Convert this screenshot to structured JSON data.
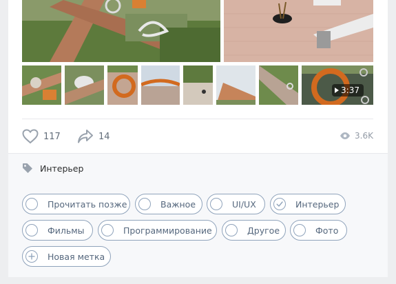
{
  "post": {
    "video_duration": "3:37",
    "likes": "117",
    "shares": "14",
    "views": "3.6K"
  },
  "tags": {
    "current": "Интерьер",
    "chips": [
      {
        "label": "Прочитать позже",
        "checked": false
      },
      {
        "label": "Важное",
        "checked": false
      },
      {
        "label": "UI/UX",
        "checked": false
      },
      {
        "label": "Интерьер",
        "checked": true
      },
      {
        "label": "Фильмы",
        "checked": false
      },
      {
        "label": "Программирование",
        "checked": false
      },
      {
        "label": "Другое",
        "checked": false
      },
      {
        "label": "Фото",
        "checked": false
      }
    ],
    "new_label": "Новая метка"
  },
  "colors": {
    "chip_border": "#8fa3bb",
    "chip_text": "#55677d",
    "panel_bg": "#f7f8fa",
    "page_bg": "#edeef0"
  }
}
